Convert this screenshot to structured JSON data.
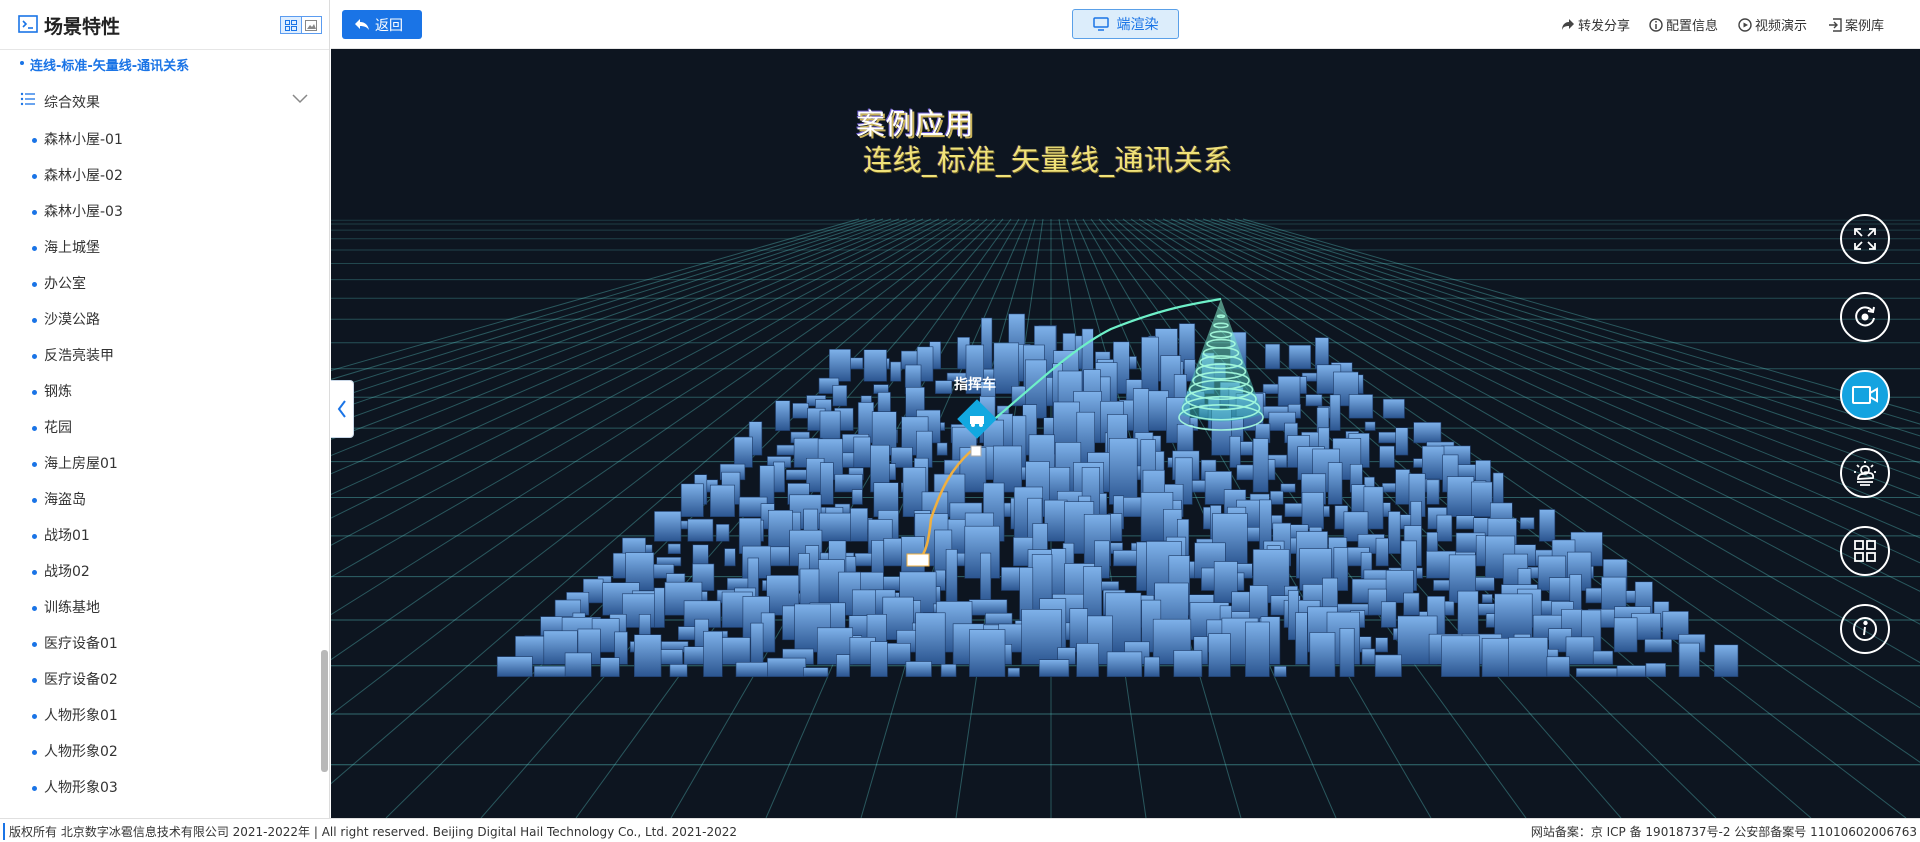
{
  "sidebar": {
    "title": "场景特性",
    "current_item": "连线-标准-矢量线-通讯关系",
    "group_label": "综合效果",
    "items": [
      "森林小屋-01",
      "森林小屋-02",
      "森林小屋-03",
      "海上城堡",
      "办公室",
      "沙漠公路",
      "反浩亮装甲",
      "钢炼",
      "花园",
      "海上房屋01",
      "海盗岛",
      "战场01",
      "战场02",
      "训练基地",
      "医疗设备01",
      "医疗设备02",
      "人物形象01",
      "人物形象02",
      "人物形象03"
    ]
  },
  "topbar": {
    "back_label": "返回",
    "render_label": "端渲染",
    "actions": [
      {
        "label": "转发分享",
        "icon": "share-icon"
      },
      {
        "label": "配置信息",
        "icon": "info-icon"
      },
      {
        "label": "视频演示",
        "icon": "play-icon"
      },
      {
        "label": "案例库",
        "icon": "exit-icon"
      }
    ]
  },
  "scene": {
    "title_line1": "案例应用",
    "title_line2": "连线_标准_矢量线_通讯关系",
    "vehicle_label": "指挥车"
  },
  "controls": [
    {
      "name": "fullscreen-icon",
      "active": false
    },
    {
      "name": "rotate-icon",
      "active": false
    },
    {
      "name": "video-camera-icon",
      "active": true
    },
    {
      "name": "weather-icon",
      "active": false
    },
    {
      "name": "grid-apps-icon",
      "active": false
    },
    {
      "name": "info-circle-icon",
      "active": false
    }
  ],
  "footer": {
    "left": "版权所有 北京数字冰雹信息技术有限公司 2021-2022年 | All right reserved. Beijing Digital Hail Technology Co., Ltd. 2021-2022",
    "right": "网站备案：京 ICP 备 19018737号-2 公安部备案号 11010602006763"
  },
  "colors": {
    "accent": "#1a74e6",
    "viewport_bg": "#0d1520",
    "signal_line": "#6ef0c8",
    "ground_path": "#f0b040",
    "active_control": "#14a3e0"
  }
}
